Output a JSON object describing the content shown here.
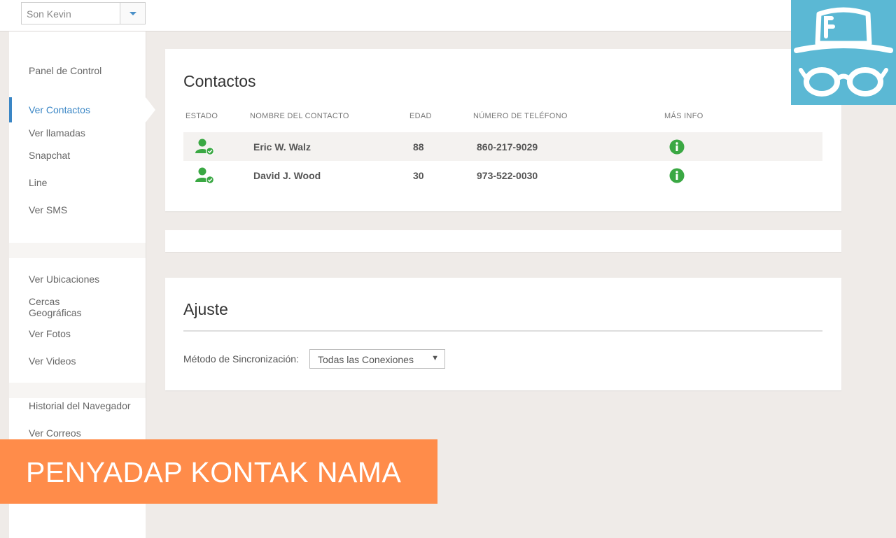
{
  "header": {
    "device_selector": "Son Kevin"
  },
  "sidebar": {
    "group1": [
      "Panel de Control",
      "Ver Contactos",
      "Ver llamadas",
      "Snapchat",
      "Line",
      "Ver SMS"
    ],
    "group2": [
      "Ver Ubicaciones",
      "Cercas Geográficas",
      "Ver Fotos",
      "Ver Videos"
    ],
    "group3": [
      "Historial del Navegador",
      "Ver Correos"
    ]
  },
  "contacts": {
    "title": "Contactos",
    "columns": [
      "ESTADO",
      "NOMBRE DEL CONTACTO",
      "EDAD",
      "NÚMERO DE TELÉFONO",
      "MÁS INFO"
    ],
    "rows": [
      {
        "name": "Eric W. Walz",
        "age": "88",
        "phone": "860-217-9029"
      },
      {
        "name": "David J. Wood",
        "age": "30",
        "phone": "973-522-0030"
      }
    ]
  },
  "settings": {
    "title": "Ajuste",
    "sync_label": "Método de Sincronización:",
    "sync_value": "Todas las Conexiones"
  },
  "banner": {
    "text": "PENYADAP KONTAK NAMA"
  },
  "colors": {
    "accent": "#3a86c5",
    "status_green": "#3aa843",
    "banner": "#ff8c4a",
    "logo_bg": "#5bb8d4"
  },
  "icons": {
    "status": "user-check-icon",
    "info": "info-icon",
    "logo": "spy-hat-glasses-icon"
  }
}
